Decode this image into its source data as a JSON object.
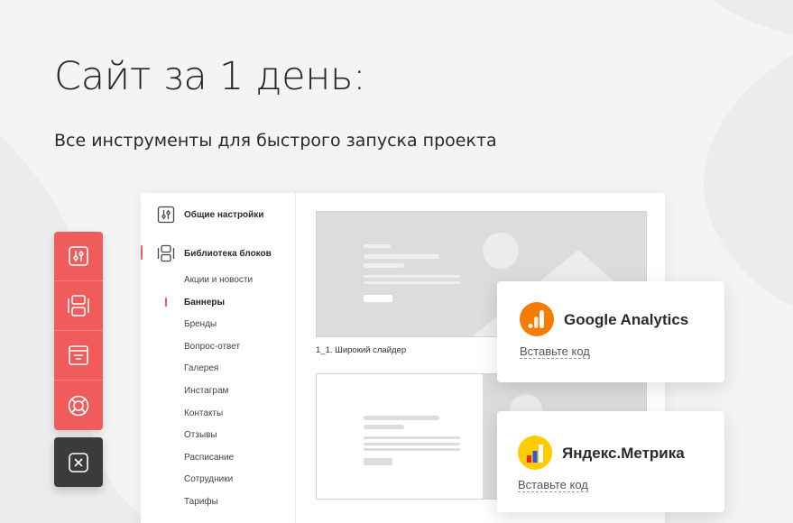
{
  "hero": {
    "title": "Сайт за 1 день:",
    "subtitle": "Все инструменты для быстрого запуска проекта"
  },
  "toolbar": {
    "accent_color": "#f05b5b",
    "dark_color": "#3b3b3b",
    "buttons": [
      {
        "icon": "sliders-icon"
      },
      {
        "icon": "blocks-icon"
      },
      {
        "icon": "layout-icon"
      },
      {
        "icon": "lifebuoy-icon"
      },
      {
        "icon": "close-icon"
      }
    ]
  },
  "admin": {
    "sidebar": {
      "general_settings": "Общие настройки",
      "block_library": "Библиотека блоков",
      "items": [
        "Акции и новости",
        "Баннеры",
        "Бренды",
        "Вопрос-ответ",
        "Галерея",
        "Инстаграм",
        "Контакты",
        "Отзывы",
        "Расписание",
        "Сотрудники",
        "Тарифы"
      ],
      "active_item": "Баннеры"
    },
    "tiles": [
      {
        "caption": "1_1. Широкий слайдер"
      },
      {
        "caption": ""
      }
    ]
  },
  "integrations": [
    {
      "name": "Google Analytics",
      "link": "Вставьте код",
      "icon": "google-analytics-icon",
      "color": "#f57c00"
    },
    {
      "name": "Яндекс.Метрика",
      "link": "Вставьте код",
      "icon": "yandex-metrika-icon",
      "color": "#ffcc00"
    }
  ]
}
